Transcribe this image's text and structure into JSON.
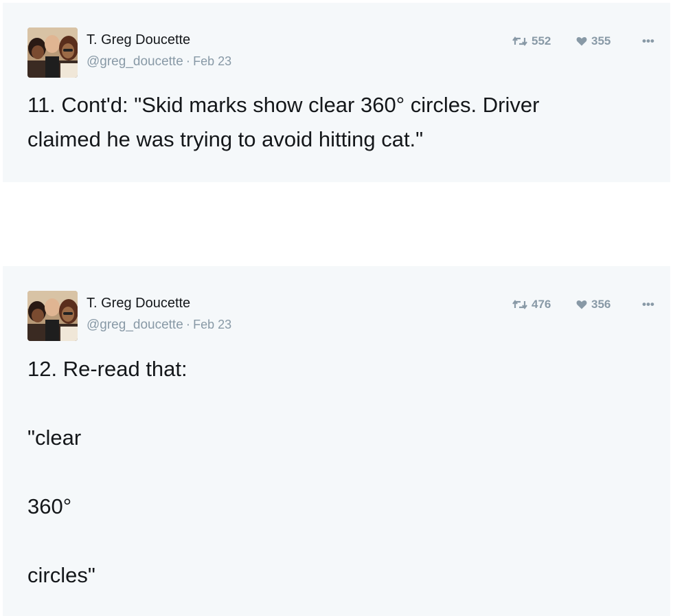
{
  "tweets": [
    {
      "author": "T. Greg Doucette",
      "handle": "@greg_doucette",
      "separator": "·",
      "date": "Feb 23",
      "retweets": "552",
      "likes": "355",
      "more_label": "•••",
      "lines": [
        "11. Cont'd: \"Skid marks show clear 360° circles. Driver",
        "claimed he was trying to avoid hitting cat.\""
      ]
    },
    {
      "author": "T. Greg Doucette",
      "handle": "@greg_doucette",
      "separator": "·",
      "date": "Feb 23",
      "retweets": "476",
      "likes": "356",
      "more_label": "•••",
      "lines": [
        "12. Re-read that:",
        "",
        "\"clear",
        "",
        "360°",
        "",
        "circles\""
      ]
    }
  ],
  "colors": {
    "card_background": "#f5f8fa",
    "text": "#14171a",
    "muted": "#8899a6"
  },
  "icons": [
    "retweet-icon",
    "heart-icon",
    "more-icon"
  ]
}
